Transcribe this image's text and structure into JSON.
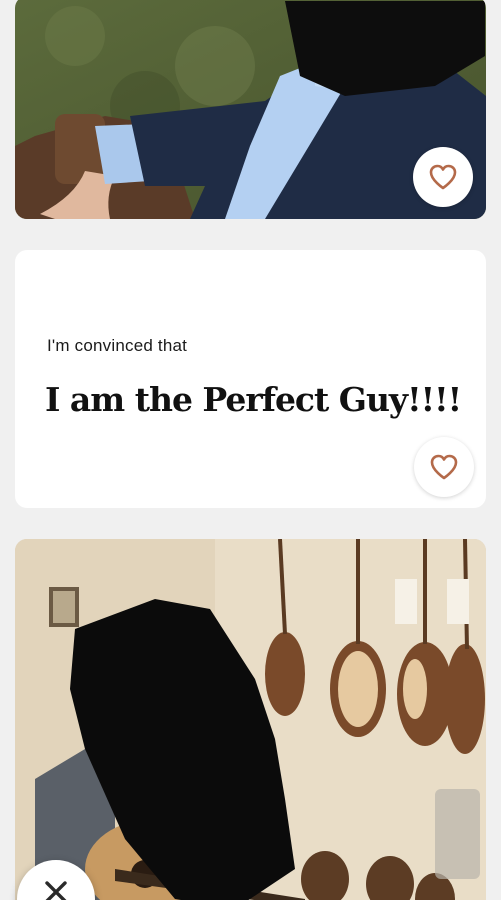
{
  "app": {
    "background": "#f0f0f0"
  },
  "photos": [
    {
      "description": "man in navy blazer and light blue shirt seated on wooden bench outdoors",
      "redacted_face": true
    },
    {
      "description": "man playing guitar in music store with guitars on wall",
      "redacted_face": true
    }
  ],
  "prompt": {
    "question": "I'm convinced that",
    "answer": "I am the Perfect Guy!!!!"
  },
  "actions": {
    "like_icon": "heart-outline-icon",
    "skip_icon": "x-icon",
    "accent_color": "#b46a4a"
  }
}
